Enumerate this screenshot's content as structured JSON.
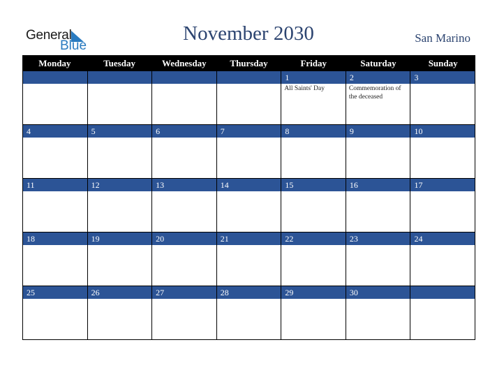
{
  "logo": {
    "line1": "General",
    "line2": "Blue"
  },
  "title": "November 2030",
  "country": "San Marino",
  "colors": {
    "header_bg": "#000000",
    "day_stripe": "#2c5496",
    "title": "#2c4470",
    "logo_blue": "#2a7bc0"
  },
  "weekdays": [
    "Monday",
    "Tuesday",
    "Wednesday",
    "Thursday",
    "Friday",
    "Saturday",
    "Sunday"
  ],
  "weeks": [
    [
      {
        "d": ""
      },
      {
        "d": ""
      },
      {
        "d": ""
      },
      {
        "d": ""
      },
      {
        "d": "1",
        "e": "All Saints' Day"
      },
      {
        "d": "2",
        "e": "Commemoration of the deceased"
      },
      {
        "d": "3"
      }
    ],
    [
      {
        "d": "4"
      },
      {
        "d": "5"
      },
      {
        "d": "6"
      },
      {
        "d": "7"
      },
      {
        "d": "8"
      },
      {
        "d": "9"
      },
      {
        "d": "10"
      }
    ],
    [
      {
        "d": "11"
      },
      {
        "d": "12"
      },
      {
        "d": "13"
      },
      {
        "d": "14"
      },
      {
        "d": "15"
      },
      {
        "d": "16"
      },
      {
        "d": "17"
      }
    ],
    [
      {
        "d": "18"
      },
      {
        "d": "19"
      },
      {
        "d": "20"
      },
      {
        "d": "21"
      },
      {
        "d": "22"
      },
      {
        "d": "23"
      },
      {
        "d": "24"
      }
    ],
    [
      {
        "d": "25"
      },
      {
        "d": "26"
      },
      {
        "d": "27"
      },
      {
        "d": "28"
      },
      {
        "d": "29"
      },
      {
        "d": "30"
      },
      {
        "d": ""
      }
    ]
  ]
}
